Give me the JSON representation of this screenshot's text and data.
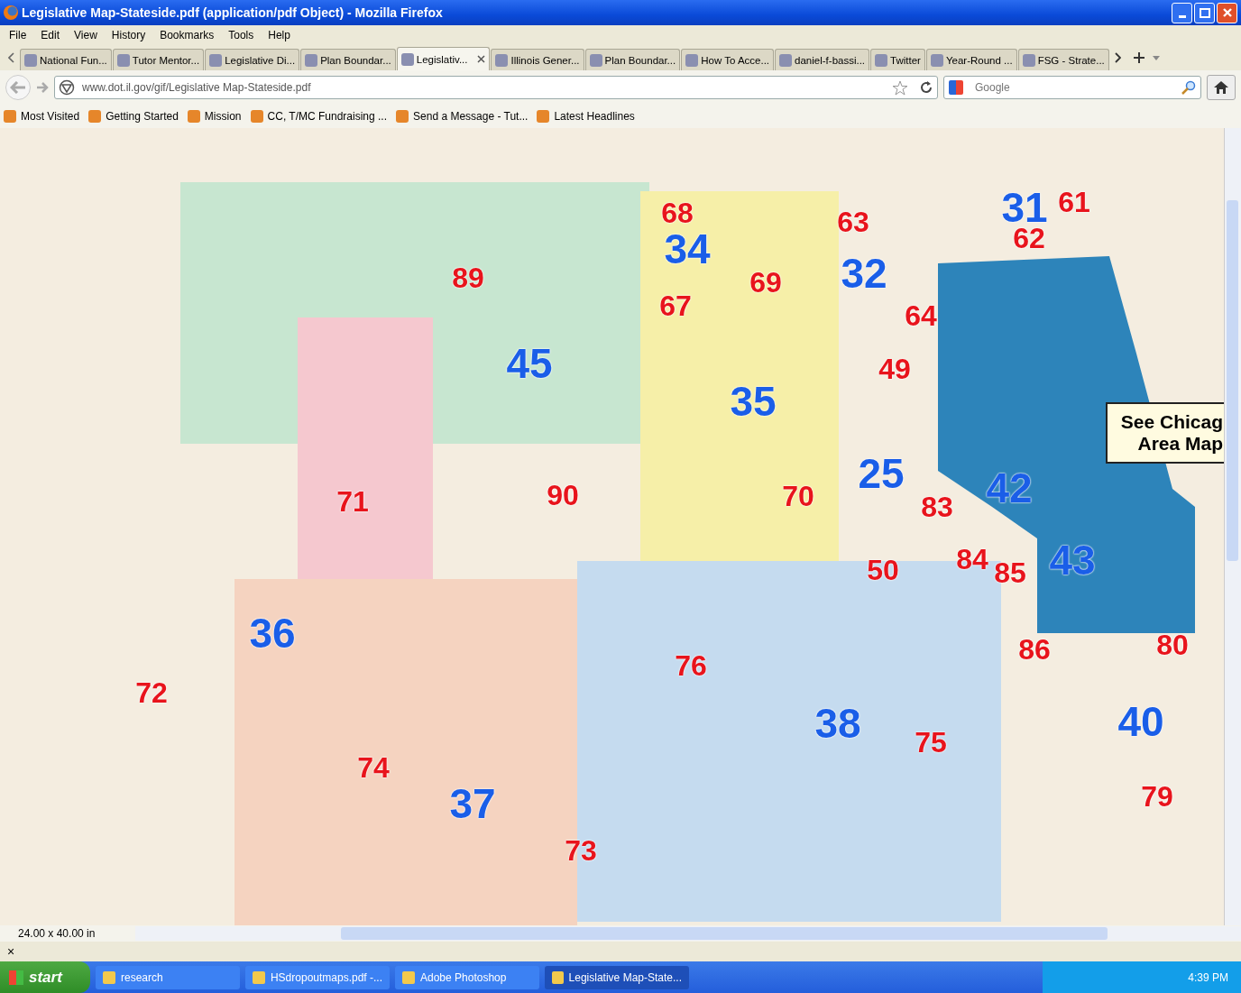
{
  "window": {
    "title": "Legislative Map-Stateside.pdf (application/pdf Object) - Mozilla Firefox"
  },
  "menu": [
    "File",
    "Edit",
    "View",
    "History",
    "Bookmarks",
    "Tools",
    "Help"
  ],
  "tabs": [
    {
      "label": "National Fun...",
      "selected": false
    },
    {
      "label": "Tutor Mentor...",
      "selected": false
    },
    {
      "label": "Legislative Di...",
      "selected": false
    },
    {
      "label": "Plan Boundar...",
      "selected": false
    },
    {
      "label": "Legislativ...",
      "selected": true
    },
    {
      "label": "Illinois Gener...",
      "selected": false
    },
    {
      "label": "Plan Boundar...",
      "selected": false
    },
    {
      "label": "How To Acce...",
      "selected": false
    },
    {
      "label": "daniel-f-bassi...",
      "selected": false
    },
    {
      "label": "Twitter",
      "selected": false
    },
    {
      "label": "Year-Round ...",
      "selected": false
    },
    {
      "label": "FSG - Strate...",
      "selected": false
    }
  ],
  "address_bar": {
    "value": "www.dot.il.gov/gif/Legislative Map-Stateside.pdf"
  },
  "search": {
    "placeholder": "Google"
  },
  "bookmarks": [
    "Most Visited",
    "Getting Started",
    "Mission",
    "CC, T/MC Fundraising ...",
    "Send a Message - Tut...",
    "Latest Headlines"
  ],
  "document": {
    "districts": [
      {
        "number": "68",
        "color": "#e8141c"
      },
      {
        "number": "63",
        "color": "#e8141c"
      },
      {
        "number": "31",
        "color": "#1a5ee8"
      },
      {
        "number": "61",
        "color": "#e8141c"
      },
      {
        "number": "34",
        "color": "#1a5ee8"
      },
      {
        "number": "62",
        "color": "#e8141c"
      },
      {
        "number": "89",
        "color": "#e8141c"
      },
      {
        "number": "69",
        "color": "#e8141c"
      },
      {
        "number": "32",
        "color": "#1a5ee8"
      },
      {
        "number": "67",
        "color": "#e8141c"
      },
      {
        "number": "64",
        "color": "#e8141c"
      },
      {
        "number": "45",
        "color": "#1a5ee8"
      },
      {
        "number": "49",
        "color": "#e8141c"
      },
      {
        "number": "35",
        "color": "#1a5ee8"
      },
      {
        "number": "25",
        "color": "#1a5ee8"
      },
      {
        "number": "42",
        "color": "#1a5ee8"
      },
      {
        "number": "71",
        "color": "#e8141c"
      },
      {
        "number": "90",
        "color": "#e8141c"
      },
      {
        "number": "70",
        "color": "#e8141c"
      },
      {
        "number": "83",
        "color": "#e8141c"
      },
      {
        "number": "50",
        "color": "#e8141c"
      },
      {
        "number": "84",
        "color": "#e8141c"
      },
      {
        "number": "85",
        "color": "#e8141c"
      },
      {
        "number": "43",
        "color": "#1a5ee8"
      },
      {
        "number": "36",
        "color": "#1a5ee8"
      },
      {
        "number": "76",
        "color": "#e8141c"
      },
      {
        "number": "86",
        "color": "#e8141c"
      },
      {
        "number": "80",
        "color": "#e8141c"
      },
      {
        "number": "72",
        "color": "#e8141c"
      },
      {
        "number": "38",
        "color": "#1a5ee8"
      },
      {
        "number": "75",
        "color": "#e8141c"
      },
      {
        "number": "40",
        "color": "#1a5ee8"
      },
      {
        "number": "74",
        "color": "#e8141c"
      },
      {
        "number": "37",
        "color": "#1a5ee8"
      },
      {
        "number": "79",
        "color": "#e8141c"
      },
      {
        "number": "73",
        "color": "#e8141c"
      }
    ],
    "callout": [
      "See Chicag",
      "Area Map"
    ]
  },
  "status_bar": {
    "page_size": "24.00 x 40.00 in"
  },
  "find_bar": {
    "close": "×"
  },
  "taskbar": {
    "start": "start",
    "tasks": [
      {
        "label": "research",
        "selected": false
      },
      {
        "label": "HSdropoutmaps.pdf -...",
        "selected": false
      },
      {
        "label": "Adobe Photoshop",
        "selected": false
      },
      {
        "label": "Legislative Map-State...",
        "selected": true
      }
    ],
    "clock": "4:39 PM"
  }
}
